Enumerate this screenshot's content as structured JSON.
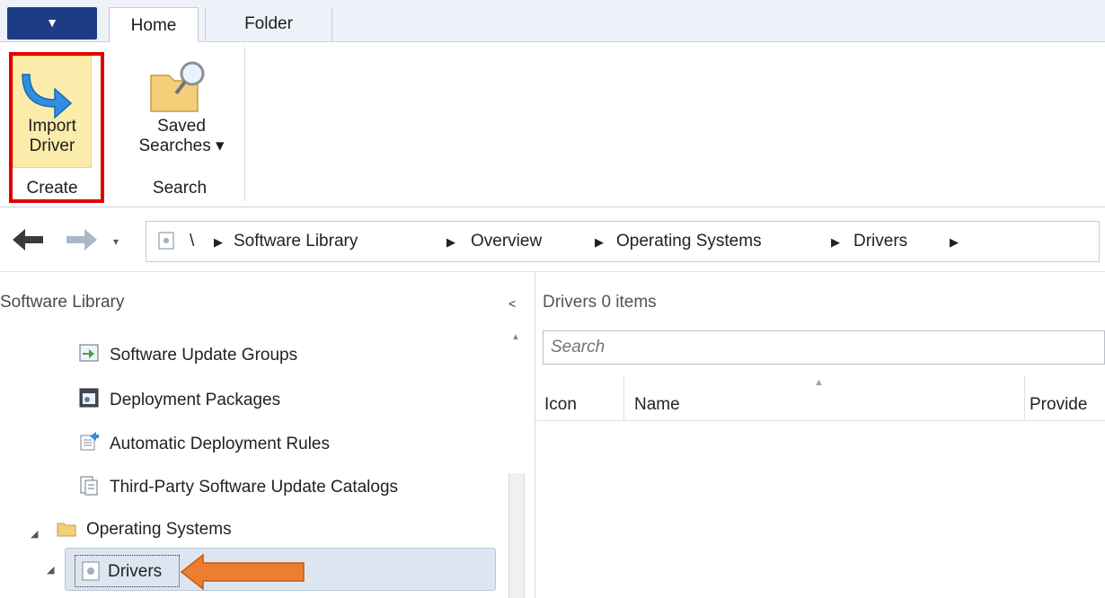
{
  "ribbon": {
    "app_button_glyph": "▼",
    "tabs": [
      {
        "label": "Home",
        "active": true
      },
      {
        "label": "Folder",
        "active": false
      }
    ],
    "groups": {
      "create": {
        "label": "Create",
        "button_label": "Import\nDriver",
        "button_icon": "blue-down-arrow-icon",
        "highlight_color": "#e10000"
      },
      "search": {
        "label": "Search",
        "button_label": "Saved Searches ▾",
        "button_icon": "folder-magnifier-icon"
      }
    }
  },
  "navigation": {
    "back_glyph": "🡐",
    "forward_glyph": "🡒",
    "history_glyph": "▾",
    "breadcrumb": {
      "root": "\\",
      "items": [
        "Software Library",
        "Overview",
        "Operating Systems",
        "Drivers"
      ],
      "separator": "▶"
    }
  },
  "left_pane": {
    "title": "Software Library",
    "collapse_glyph": "<",
    "items": [
      {
        "label": "Software Update Groups",
        "icon": "update-group-icon"
      },
      {
        "label": "Deployment Packages",
        "icon": "deployment-package-icon"
      },
      {
        "label": "Automatic Deployment Rules",
        "icon": "deployment-rules-icon"
      },
      {
        "label": "Third-Party Software Update Catalogs",
        "icon": "catalog-icon"
      },
      {
        "label": "Operating Systems",
        "icon": "folder-icon",
        "expanded": true
      },
      {
        "label": "Drivers",
        "icon": "driver-icon",
        "expanded": true,
        "selected": true
      }
    ],
    "expand_glyph": "◢"
  },
  "main": {
    "list_title": "Drivers 0 items",
    "search_placeholder": "Search",
    "columns": [
      "Icon",
      "Name",
      "Provide"
    ]
  },
  "colors": {
    "accent_highlight": "#e10000",
    "annotation_arrow": "#ed7d31",
    "selected_row_bg": "#dde5f0",
    "app_button": "#1c3d86"
  }
}
